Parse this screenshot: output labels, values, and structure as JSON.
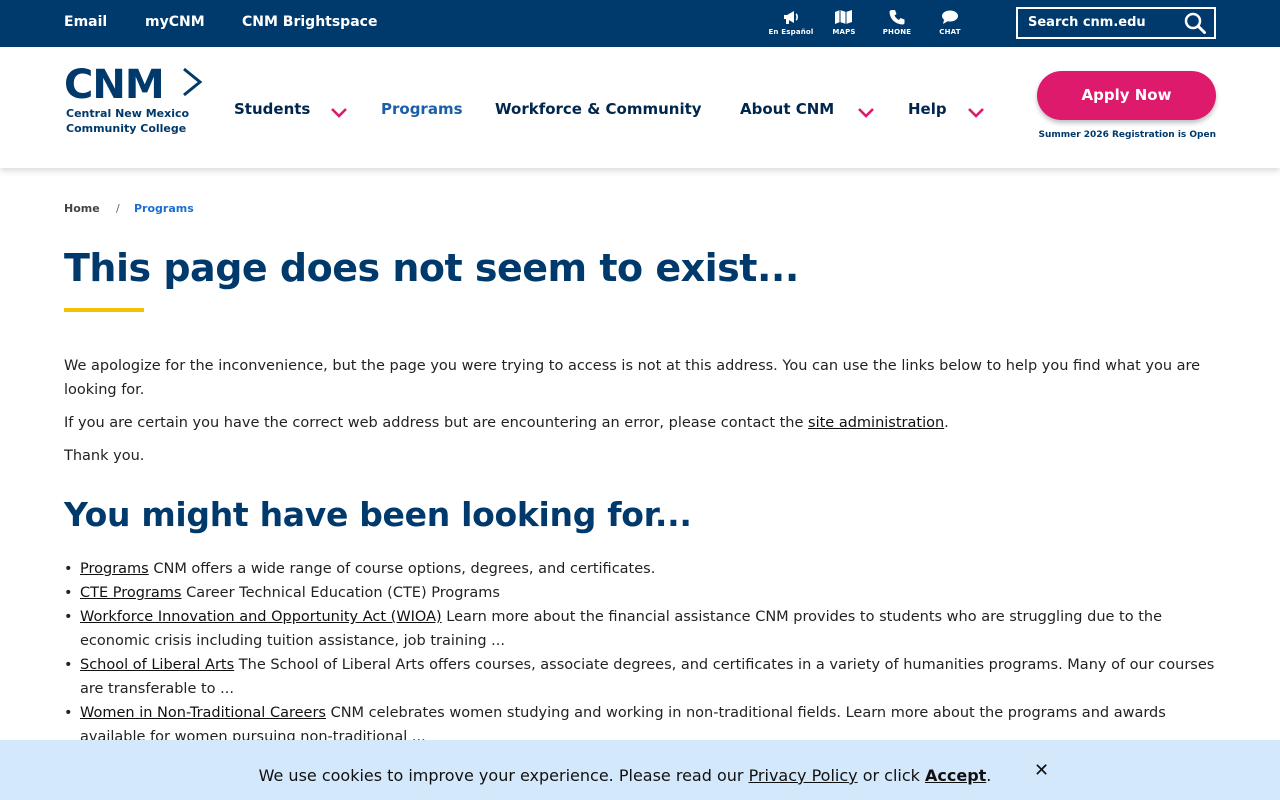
{
  "topbar": {
    "links": [
      "Email",
      "myCNM",
      "CNM Brightspace"
    ],
    "utilities": [
      {
        "label": "En Español",
        "icon": "megaphone-icon"
      },
      {
        "label": "MAPS",
        "icon": "map-icon"
      },
      {
        "label": "PHONE",
        "icon": "phone-icon"
      },
      {
        "label": "CHAT",
        "icon": "chat-icon"
      }
    ],
    "search_label": "Search cnm.edu"
  },
  "header": {
    "logo_mark": "CNM",
    "logo_line1": "Central New Mexico",
    "logo_line2": "Community College",
    "nav": [
      {
        "label": "Students",
        "dropdown": true
      },
      {
        "label": "Programs",
        "dropdown": false
      },
      {
        "label": "Workforce & Community",
        "dropdown": false
      },
      {
        "label": "About CNM",
        "dropdown": true
      },
      {
        "label": "Help",
        "dropdown": true
      }
    ],
    "apply_label": "Apply Now",
    "registration_note": "Summer 2026 Registration is Open"
  },
  "breadcrumb": {
    "home": "Home",
    "separator": "/",
    "current": "Programs"
  },
  "main": {
    "title": "This page does not seem to exist...",
    "para1": "We apologize for the inconvenience, but the page you were trying to access is not at this address. You can use the links below to help you find what you are looking for.",
    "para2_before": "If you are certain you have the correct web address but are encountering an error, please contact the ",
    "para2_link": "site administration",
    "para2_after": ".",
    "para3": "Thank you.",
    "subtitle": "You might have been looking for...",
    "results": [
      {
        "link": "Programs",
        "desc": " CNM offers a wide range of course options, degrees, and certificates."
      },
      {
        "link": "CTE Programs",
        "desc": " Career Technical Education (CTE) Programs"
      },
      {
        "link": "Workforce Innovation and Opportunity Act (WIOA)",
        "desc": " Learn more about the financial assistance CNM provides to students who are struggling due to the economic crisis including tuition assistance, job training ..."
      },
      {
        "link": "School of Liberal Arts",
        "desc": " The School of Liberal Arts offers courses, associate degrees, and certificates in a variety of humanities programs. Many of our courses are transferable to ..."
      },
      {
        "link": "Women in Non-Traditional Careers",
        "desc": " CNM celebrates women studying and working in non-traditional fields. Learn more about the programs and awards available for women pursuing non-traditional ..."
      }
    ]
  },
  "cookie": {
    "text_before": "We use cookies to improve your experience. Please read our ",
    "privacy_link": "Privacy Policy",
    "text_middle": " or click ",
    "accept_link": "Accept",
    "text_after": ".",
    "close_symbol": "✕"
  },
  "colors": {
    "navy": "#00396b",
    "apply_pink": "#de1a6c",
    "accent_yellow": "#f2c200",
    "link_blue": "#1a6fd0",
    "cookie_bg": "#d4e8fb"
  }
}
